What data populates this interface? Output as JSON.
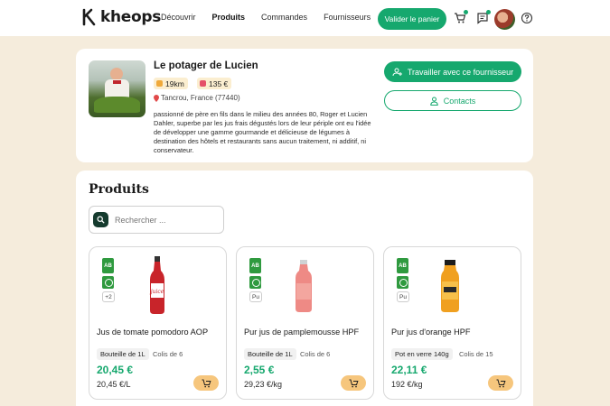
{
  "header": {
    "brand": "kheops",
    "nav": [
      {
        "label": "Découvrir",
        "active": false
      },
      {
        "label": "Produits",
        "active": true
      },
      {
        "label": "Commandes",
        "active": false
      },
      {
        "label": "Fournisseurs",
        "active": false
      }
    ],
    "cart_button": "Valider le panier",
    "icons": [
      "cart-icon",
      "message-icon",
      "avatar",
      "help-icon"
    ],
    "accent": "#16a86e"
  },
  "supplier": {
    "name": "Le potager de Lucien",
    "distance": "19km",
    "minimum": "135 €",
    "location": "Tancrou, France (77440)",
    "description": "passionné de père en fils dans le milieu des années 80, Roger et Lucien Dahler, superbe par les jus frais dégustés lors de leur périple ont eu l'idée de développer une gamme gourmande et délicieuse de légumes à destination des hôtels et restaurants sans aucun traitement, ni additif, ni conservateur.",
    "work_button": "Travailler avec ce fournisseur",
    "contacts_button": "Contacts"
  },
  "products": {
    "title": "Produits",
    "search_placeholder": "Rechercher ...",
    "items": [
      {
        "name": "Jus de tomate pomodoro AOP",
        "format": "Bouteille de 1L",
        "colis": "Colis de 6",
        "price": "20,45 €",
        "unit_price": "20,45 €/L",
        "extra_labels": "+2",
        "bottle_color": "#c8242a"
      },
      {
        "name": "Pur jus de pamplemousse HPF",
        "format": "Bouteille de 1L",
        "colis": "Colis de 6",
        "price": "2,55 €",
        "unit_price": "29,23 €/kg",
        "extra_labels": "Pu",
        "bottle_color": "#ee8a85"
      },
      {
        "name": "Pur jus d'orange HPF",
        "format": "Pot en verre 140g",
        "colis": "Colis de 15",
        "price": "22,11 €",
        "unit_price": "192 €/kg",
        "extra_labels": "Pu",
        "bottle_color": "#f0a020"
      }
    ]
  }
}
